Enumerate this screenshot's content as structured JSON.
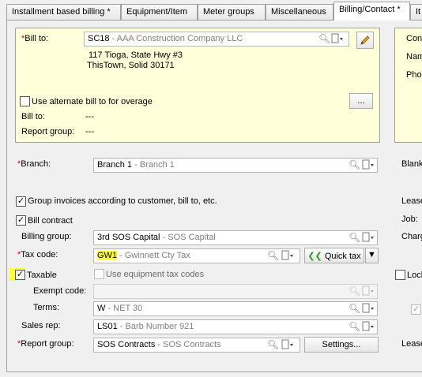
{
  "tabs": [
    {
      "label": "Installment based billing *"
    },
    {
      "label": "Equipment/Item"
    },
    {
      "label": "Meter groups"
    },
    {
      "label": "Miscellaneous"
    },
    {
      "label": "Billing/Contact *"
    },
    {
      "label": "It"
    }
  ],
  "bill_to": {
    "label": "Bill to:",
    "required_mark": "*",
    "code": "SC18",
    "desc": "- AAA Construction Company LLC",
    "address_line1": "117 Tioga, State Hwy #3",
    "address_line2": "ThisTown, Solid 30171",
    "alt_checkbox_label": "Use alternate bill to for overage",
    "ellipsis_label": "...",
    "alt_bill_to_label": "Bill to:",
    "alt_bill_to_value": "---",
    "report_group_label": "Report group:",
    "report_group_value": "---"
  },
  "right_contact": {
    "con": "Con",
    "nam": "Nam",
    "pho": "Pho"
  },
  "branch": {
    "required_mark": "*",
    "label": "Branch:",
    "code": "Branch 1",
    "desc": "- Branch 1"
  },
  "right_side": {
    "blank": "Blank",
    "lease": "Lease",
    "job": "Job:",
    "charg": "Charg",
    "lock": "Lock",
    "lease2": "Lease"
  },
  "group_invoices": {
    "label": "Group invoices according to customer, bill to, etc.",
    "checked": true
  },
  "bill_contract": {
    "label": "Bill contract",
    "checked": true
  },
  "billing_group": {
    "label": "Billing group:",
    "code": "3rd SOS Capital",
    "desc": "- SOS Capital"
  },
  "tax_code": {
    "required_mark": "*",
    "label": "Tax code:",
    "code": "GW1",
    "desc": "- Gwinnett Cty Tax",
    "quick_tax_label": "Quick tax",
    "quick_tax_icon": "double-chevron-left"
  },
  "taxable": {
    "label": "Taxable",
    "checked": true
  },
  "use_equipment_tax": {
    "label": "Use equipment tax codes",
    "checked": false
  },
  "exempt_code": {
    "label": "Exempt code:",
    "value": ""
  },
  "terms": {
    "label": "Terms:",
    "code": "W",
    "desc": "- NET 30"
  },
  "sales_rep": {
    "label": "Sales rep:",
    "code": "LS01",
    "desc": "- Barb Number 921"
  },
  "report_group": {
    "required_mark": "*",
    "label": "Report group:",
    "code": "SOS Contracts",
    "desc": "- SOS Contracts",
    "settings_label": "Settings..."
  },
  "colors": {
    "info_panel": "#ffffd9",
    "required": "#d00000",
    "highlight": "#ffff33",
    "quick_tax_green": "#2e9d2e"
  }
}
